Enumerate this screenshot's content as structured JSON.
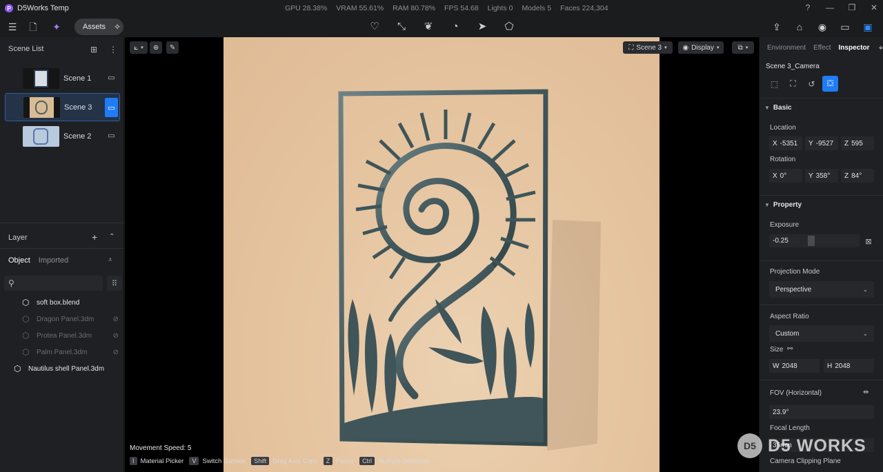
{
  "app": {
    "logo_letter": "P",
    "title": "D5Works Temp"
  },
  "stats": [
    "GPU 28.38%",
    "VRAM 55.61%",
    "RAM 80.78%",
    "FPS 54.68",
    "Lights 0",
    "Models 5",
    "Faces 224,304"
  ],
  "window_controls": {
    "help": "?",
    "minimize": "—",
    "maximize": "❐",
    "close": "✕"
  },
  "toolbar": {
    "assets_label": "Assets"
  },
  "scene_list": {
    "title": "Scene List",
    "items": [
      {
        "label": "Scene 1",
        "selected": false,
        "thumb_color": "#2c3a55"
      },
      {
        "label": "Scene 3",
        "selected": true,
        "thumb_color": "#b99a72"
      },
      {
        "label": "Scene 2",
        "selected": false,
        "thumb_color": "#8fa6c6"
      }
    ]
  },
  "layer": {
    "title": "Layer",
    "tab_object": "Object",
    "tab_imported": "Imported",
    "objects": [
      {
        "label": "soft box.blend",
        "visible": true
      },
      {
        "label": "Dragon Panel.3dm",
        "visible": false
      },
      {
        "label": "Protea Panel.3dm",
        "visible": false
      },
      {
        "label": "Palm Panel.3dm",
        "visible": false
      },
      {
        "label": "Nautilus shell Panel.3dm",
        "visible": true
      }
    ]
  },
  "viewport": {
    "scene_selector": "Scene 3",
    "display_label": "Display",
    "movement_speed": "Movement Speed: 5",
    "shortcuts": [
      {
        "key": "I",
        "label": "Material Picker"
      },
      {
        "key": "V",
        "label": "Switch Gizmos"
      },
      {
        "key": "Shift",
        "label": "Drag Axis Copy"
      },
      {
        "key": "Z",
        "label": "Focus"
      },
      {
        "key": "Ctrl",
        "label": "Multiple Selection"
      }
    ],
    "watermark": "D5 WORKS",
    "watermark_logo": "D5",
    "panel_color": "#3f5559",
    "backdrop_color": "#e6c5a1"
  },
  "inspector": {
    "tabs": [
      "Environment",
      "Effect",
      "Inspector"
    ],
    "active_tab": "Inspector",
    "title": "Scene 3_Camera",
    "basic": {
      "header": "Basic",
      "location_label": "Location",
      "location": {
        "x": "-5351",
        "y": "-9527",
        "z": "595"
      },
      "rotation_label": "Rotation",
      "rotation": {
        "x": "0°",
        "y": "358°",
        "z": "84°"
      }
    },
    "property": {
      "header": "Property",
      "exposure_label": "Exposure",
      "exposure_value": "-0.25",
      "projection_label": "Projection Mode",
      "projection_value": "Perspective",
      "aspect_label": "Aspect Ratio",
      "aspect_value": "Custom",
      "size_label": "Size",
      "width": "2048",
      "height": "2048",
      "fov_label": "FOV (Horizontal)",
      "fov_value": "23.9°",
      "focal_label": "Focal Length",
      "focal_value": "35mm",
      "clipping_label": "Camera Clipping Plane"
    },
    "accent_color": "#1f7cf5"
  }
}
